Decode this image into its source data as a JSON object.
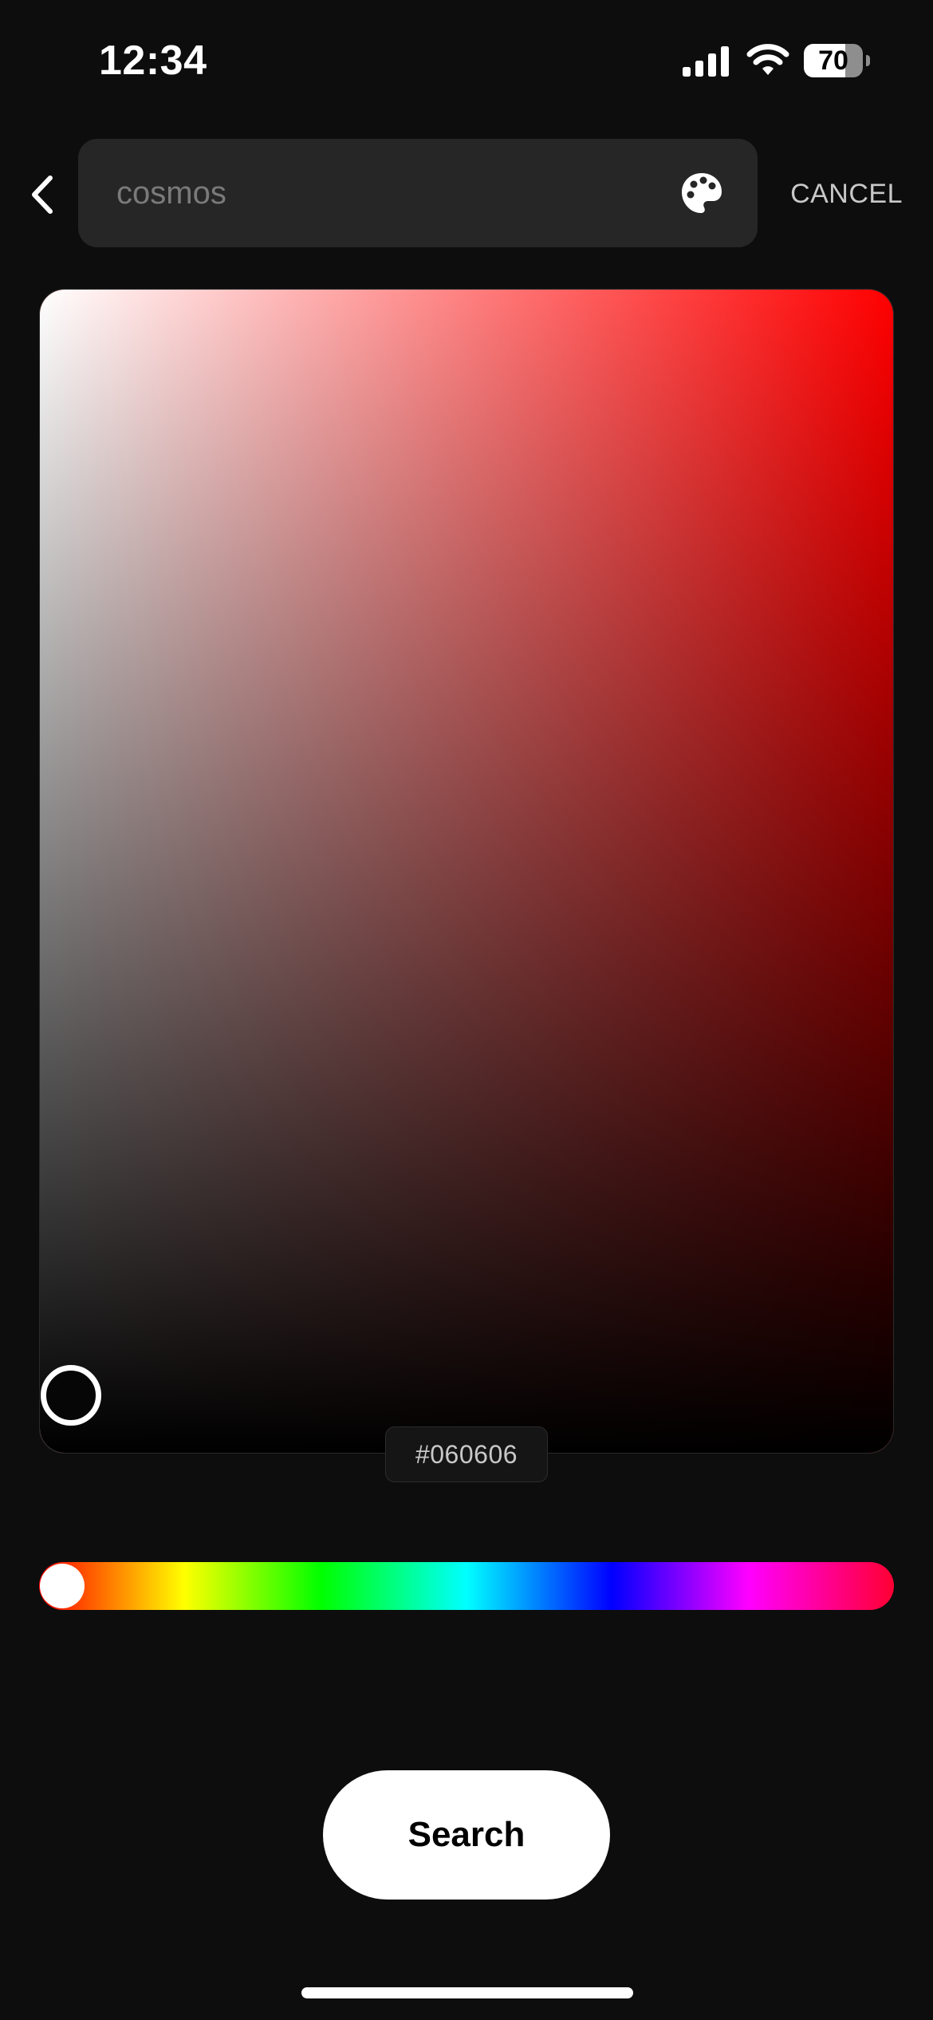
{
  "status_bar": {
    "time": "12:34",
    "battery_percent": "70",
    "battery_level": 0.7,
    "icons": [
      "cellular-signal-icon",
      "wifi-icon",
      "battery-icon"
    ]
  },
  "header": {
    "back_icon": "chevron-left-icon",
    "search_placeholder": "cosmos",
    "search_value": "",
    "palette_icon": "palette-icon",
    "cancel_label": "CANCEL"
  },
  "color_picker": {
    "hue_color": "#ff0000",
    "selected_hex": "#060606",
    "saturation": 0.0,
    "brightness": 0.024,
    "hue_degrees": 0,
    "hue_gradient_stops": [
      "#ff0000",
      "#ffff00",
      "#00ff00",
      "#00ffff",
      "#0000ff",
      "#ff00ff",
      "#ff0033"
    ]
  },
  "actions": {
    "search_label": "Search"
  },
  "colors": {
    "background": "#0d0d0d",
    "field_background": "#262626",
    "placeholder_text": "#7a7a7a",
    "cancel_text": "#c8c8c8",
    "button_background": "#ffffff",
    "button_text": "#000000"
  }
}
